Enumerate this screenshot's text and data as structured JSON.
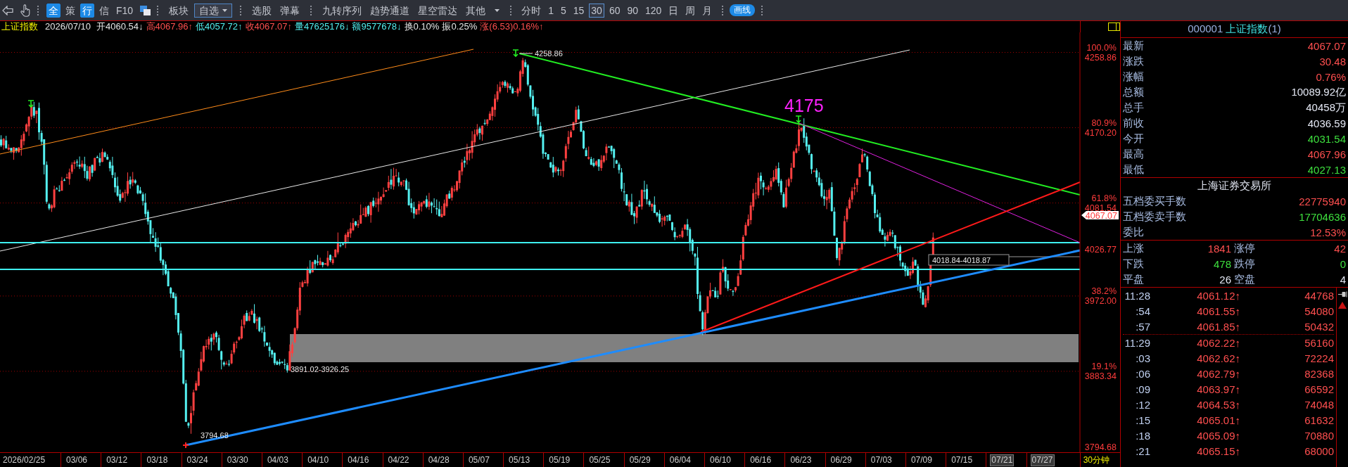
{
  "toolbar": {
    "modes": [
      {
        "label": "全",
        "selected": true
      },
      {
        "label": "策",
        "selected": false
      },
      {
        "label": "行",
        "selected": true
      },
      {
        "label": "信",
        "selected": false
      },
      {
        "label": "F10",
        "selected": false
      }
    ],
    "blocks": [
      {
        "label": "板块",
        "selected": false,
        "dropdown": false
      },
      {
        "label": "自选",
        "selected": true,
        "dropdown": true
      }
    ],
    "actions": [
      "选股",
      "弹幕"
    ],
    "indicators": [
      "九转序列",
      "趋势通道",
      "星空雷达"
    ],
    "more": "其他",
    "periods": [
      {
        "label": "分时",
        "selected": false
      },
      {
        "label": "1",
        "selected": false
      },
      {
        "label": "5",
        "selected": false
      },
      {
        "label": "15",
        "selected": false
      },
      {
        "label": "30",
        "selected": true
      },
      {
        "label": "60",
        "selected": false
      },
      {
        "label": "90",
        "selected": false
      },
      {
        "label": "120",
        "selected": false
      },
      {
        "label": "日",
        "selected": false
      },
      {
        "label": "周",
        "selected": false
      },
      {
        "label": "月",
        "selected": false
      }
    ],
    "draw_button": "画线"
  },
  "quote_bar": {
    "name": "上证指数",
    "date": "2026/07/10",
    "fields": [
      {
        "text": "开4060.54↓",
        "color": "#e6e6e6"
      },
      {
        "text": "高4067.96↑",
        "color": "#ff4f4f"
      },
      {
        "text": "低4057.72↑",
        "color": "#52f0f0"
      },
      {
        "text": "收4067.07↑",
        "color": "#ff4f4f"
      },
      {
        "text": "量47625176↓",
        "color": "#52f0f0"
      },
      {
        "text": "额9577678↓",
        "color": "#52f0f0"
      },
      {
        "text": "换0.10%",
        "color": "#e6e6e6"
      },
      {
        "text": "振0.25%",
        "color": "#e6e6e6"
      },
      {
        "text": "涨(6.53)0.16%↑",
        "color": "#ff4f4f"
      }
    ]
  },
  "chart": {
    "levels": [
      {
        "percent": "100.0%",
        "price": "4258.86"
      },
      {
        "percent": "80.9%",
        "price": "4170.20"
      },
      {
        "percent": "61.8%",
        "price": "4081.54"
      },
      {
        "percent": "38.2%",
        "price": "3972.00"
      },
      {
        "percent": "19.1%",
        "price": "3883.34"
      }
    ],
    "bottom_price": "3794.68",
    "marked_price": "4026.77",
    "last_price": "4067.07",
    "peak_label": "4258.86",
    "low_label": "3794.68",
    "zone_label": "3891.02-3926.25",
    "gap_label": "4018.84-4018.87",
    "target_label": "4175"
  },
  "date_axis": {
    "dates": [
      {
        "label": "2026/02/25",
        "future": false
      },
      {
        "label": "03/06",
        "future": false
      },
      {
        "label": "03/12",
        "future": false
      },
      {
        "label": "03/18",
        "future": false
      },
      {
        "label": "03/24",
        "future": false
      },
      {
        "label": "03/30",
        "future": false
      },
      {
        "label": "04/03",
        "future": false
      },
      {
        "label": "04/10",
        "future": false
      },
      {
        "label": "04/16",
        "future": false
      },
      {
        "label": "04/22",
        "future": false
      },
      {
        "label": "04/28",
        "future": false
      },
      {
        "label": "05/07",
        "future": false
      },
      {
        "label": "05/13",
        "future": false
      },
      {
        "label": "05/19",
        "future": false
      },
      {
        "label": "05/25",
        "future": false
      },
      {
        "label": "05/29",
        "future": false
      },
      {
        "label": "06/04",
        "future": false
      },
      {
        "label": "06/10",
        "future": false
      },
      {
        "label": "06/16",
        "future": false
      },
      {
        "label": "06/23",
        "future": false
      },
      {
        "label": "06/29",
        "future": false
      },
      {
        "label": "07/03",
        "future": false
      },
      {
        "label": "07/09",
        "future": false
      },
      {
        "label": "07/15",
        "future": false
      },
      {
        "label": "07/21",
        "future": true
      },
      {
        "label": "07/27",
        "future": true
      }
    ],
    "period": "30分钟"
  },
  "quote_panel": {
    "code": "000001",
    "name": "上证指数",
    "suffix": "(1)",
    "rows": [
      {
        "label": "最新",
        "value": "4067.07",
        "color": "#ff4f4f"
      },
      {
        "label": "涨跌",
        "value": "30.48",
        "color": "#ff4f4f"
      },
      {
        "label": "涨幅",
        "value": "0.76%",
        "color": "#ff4f4f"
      },
      {
        "label": "总额",
        "value": "10089.92亿",
        "color": "#e4e8f4"
      },
      {
        "label": "总手",
        "value": "40458万",
        "color": "#e4e8f4"
      },
      {
        "label": "前收",
        "value": "4036.59",
        "color": "#e4e8f4"
      },
      {
        "label": "今开",
        "value": "4031.54",
        "color": "#3ee03e"
      },
      {
        "label": "最高",
        "value": "4067.96",
        "color": "#ff4f4f"
      },
      {
        "label": "最低",
        "value": "4027.13",
        "color": "#3ee03e"
      }
    ],
    "exchange": {
      "title": "上海证券交易所",
      "rows": [
        {
          "label": "五档委买手数",
          "value": "22775940",
          "color": "#ff4f4f"
        },
        {
          "label": "五档委卖手数",
          "value": "17704636",
          "color": "#3ee03e"
        },
        {
          "label": "委比",
          "value": "12.53%",
          "color": "#ff4f4f"
        }
      ]
    },
    "breadth": [
      {
        "label": "上涨",
        "value": "1841",
        "limit_label": "涨停",
        "limit_value": "42",
        "color": "#ff4f4f"
      },
      {
        "label": "下跌",
        "value": "478",
        "limit_label": "跌停",
        "limit_value": "0",
        "color": "#3ee03e"
      },
      {
        "label": "平盘",
        "value": "26",
        "limit_label": "空盘",
        "limit_value": "4",
        "color": "#e4e8f4"
      }
    ],
    "ticks": [
      {
        "rows": [
          {
            "time": "11:28",
            "price": "4061.12↑",
            "volume": "44768"
          },
          {
            "time": ":54",
            "price": "4061.55↑",
            "volume": "54080"
          },
          {
            "time": ":57",
            "price": "4061.85↑",
            "volume": "50432"
          }
        ]
      },
      {
        "rows": [
          {
            "time": "11:29",
            "price": "4062.22↑",
            "volume": "56160"
          },
          {
            "time": ":03",
            "price": "4062.62↑",
            "volume": "72224"
          },
          {
            "time": ":06",
            "price": "4062.79↑",
            "volume": "82368"
          },
          {
            "time": ":09",
            "price": "4063.97↑",
            "volume": "66592"
          },
          {
            "time": ":12",
            "price": "4064.53↑",
            "volume": "74048"
          },
          {
            "time": ":15",
            "price": "4065.01↑",
            "volume": "61632"
          },
          {
            "time": ":18",
            "price": "4065.09↑",
            "volume": "70880"
          },
          {
            "time": ":21",
            "price": "4065.15↑",
            "volume": "68000"
          }
        ]
      }
    ]
  }
}
